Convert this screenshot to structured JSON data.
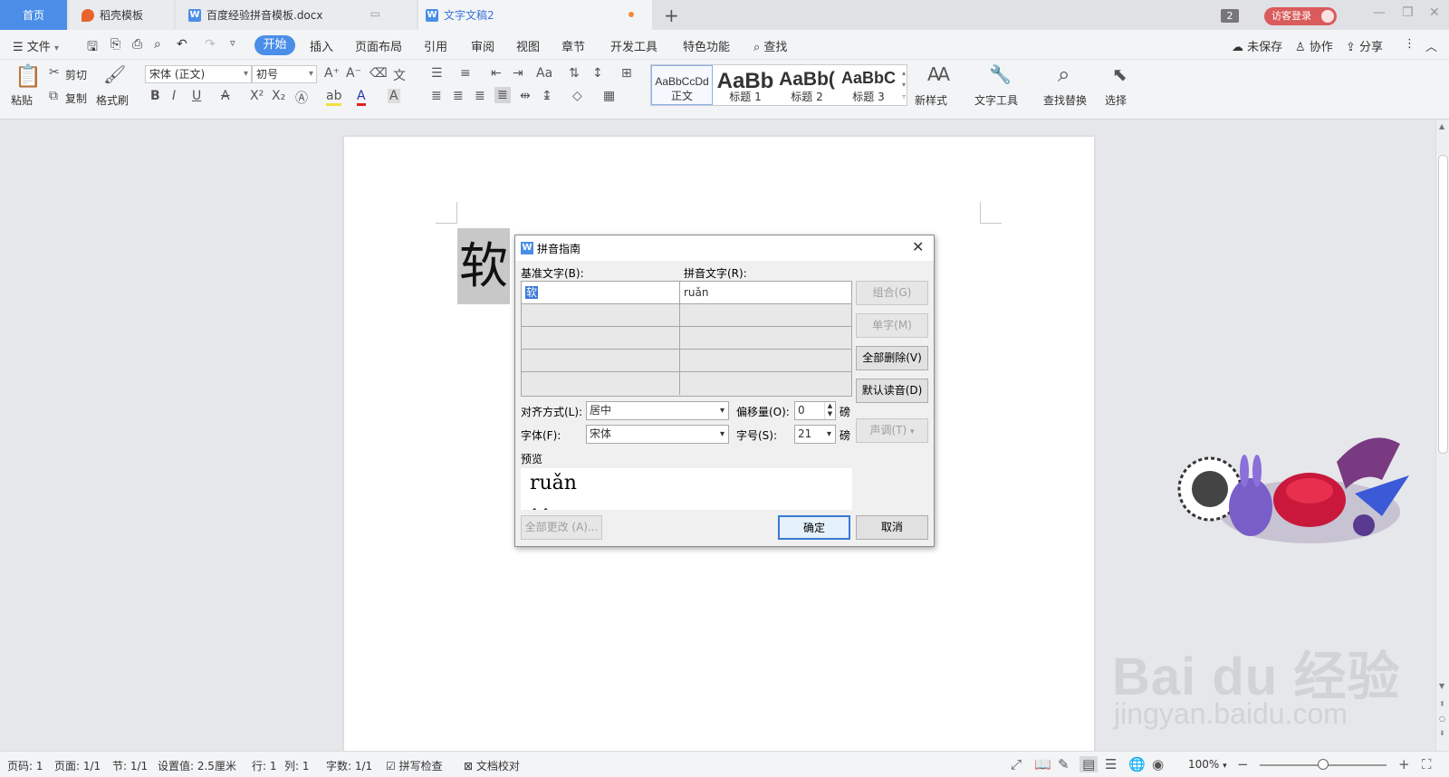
{
  "tabs": [
    {
      "label": "首页"
    },
    {
      "label": "稻壳模板"
    },
    {
      "label": "百度经验拼音模板.docx"
    },
    {
      "label": "文字文稿2"
    }
  ],
  "tab_count": "2",
  "login_label": "访客登录",
  "menu": {
    "file": "文件",
    "items": [
      "开始",
      "插入",
      "页面布局",
      "引用",
      "审阅",
      "视图",
      "章节",
      "开发工具",
      "特色功能"
    ],
    "search": "查找",
    "unsaved": "未保存",
    "collab": "协作",
    "share": "分享"
  },
  "ribbon": {
    "paste": "粘贴",
    "cut": "剪切",
    "copy": "复制",
    "format_painter": "格式刷",
    "font_name": "宋体 (正文)",
    "font_size": "初号",
    "styles": [
      {
        "sample": "AaBbCcDd",
        "name": "正文"
      },
      {
        "sample": "AaBb",
        "name": "标题 1"
      },
      {
        "sample": "AaBb(",
        "name": "标题 2"
      },
      {
        "sample": "AaBbC",
        "name": "标题 3"
      }
    ],
    "new_style": "新样式",
    "text_tools": "文字工具",
    "find_replace": "查找替换",
    "select": "选择"
  },
  "document": {
    "ruby_char": "软"
  },
  "dialog": {
    "title": "拼音指南",
    "base_label": "基准文字(B):",
    "ruby_label": "拼音文字(R):",
    "rows": [
      {
        "base": "软",
        "ruby": "ruǎn"
      },
      {
        "base": "",
        "ruby": ""
      },
      {
        "base": "",
        "ruby": ""
      },
      {
        "base": "",
        "ruby": ""
      },
      {
        "base": "",
        "ruby": ""
      }
    ],
    "buttons": {
      "combine": "组合(G)",
      "single": "单字(M)",
      "clear_all": "全部删除(V)",
      "default_reading": "默认读音(D)",
      "tone": "声调(T)",
      "change_all": "全部更改 (A)...",
      "ok": "确定",
      "cancel": "取消"
    },
    "align_label": "对齐方式(L):",
    "align_value": "居中",
    "offset_label": "偏移量(O):",
    "offset_value": "0",
    "offset_unit": "磅",
    "font_label": "字体(F):",
    "font_value": "宋体",
    "size_label": "字号(S):",
    "size_value": "21",
    "size_unit": "磅",
    "preview_label": "预览",
    "preview_pinyin": "ruǎn"
  },
  "status": {
    "page": "页码: 1",
    "pages": "页面: 1/1",
    "section": "节: 1/1",
    "setting": "设置值: 2.5厘米",
    "row": "行: 1",
    "col": "列: 1",
    "words": "字数: 1/1",
    "spell": "拼写检查",
    "proof": "文档校对",
    "zoom": "100%"
  },
  "watermark": {
    "brand": "Bai du 经验",
    "url": "jingyan.baidu.com"
  },
  "colors": {
    "accent": "#4a8ee8",
    "login": "#d95b5b"
  }
}
